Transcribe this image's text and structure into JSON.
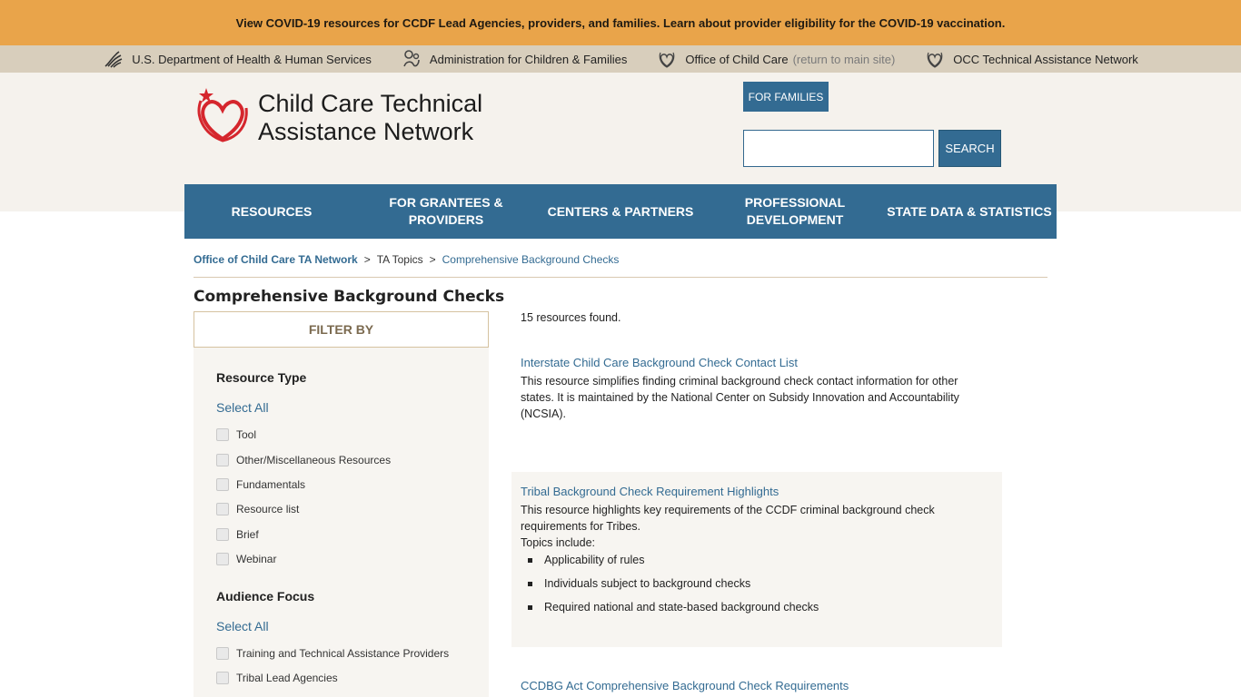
{
  "covid_banner": {
    "text": "View COVID-19 resources for CCDF Lead Agencies, providers, and families. Learn about provider eligibility for the COVID-19 vaccination."
  },
  "agency_bar": {
    "items": [
      {
        "label": "U.S. Department of Health & Human Services",
        "icon": "hhs-eagle-icon"
      },
      {
        "label": "Administration for Children & Families",
        "icon": "acf-icon"
      },
      {
        "label": "Office of Child Care",
        "suffix": "(return to main site)",
        "icon": "occ-heart-icon"
      },
      {
        "label": "OCC Technical Assistance Network",
        "icon": "occ-heart-icon"
      }
    ]
  },
  "header": {
    "logo_line1": "Child Care Technical",
    "logo_line2": "Assistance Network",
    "for_families": "FOR FAMILIES",
    "search_placeholder": "",
    "search_button": "SEARCH"
  },
  "nav": {
    "items": [
      {
        "label": "RESOURCES"
      },
      {
        "label": "FOR GRANTEES & PROVIDERS"
      },
      {
        "label": "CENTERS & PARTNERS"
      },
      {
        "label": "PROFESSIONAL DEVELOPMENT"
      },
      {
        "label": "STATE DATA & STATISTICS"
      }
    ]
  },
  "breadcrumb": {
    "items": [
      "Office of Child Care TA Network",
      "TA Topics",
      "Comprehensive Background Checks"
    ],
    "separator": ">"
  },
  "page_title": "Comprehensive Background Checks",
  "filter": {
    "heading": "FILTER BY",
    "groups": [
      {
        "title": "Resource Type",
        "select_all": "Select All",
        "options": [
          "Tool",
          "Other/Miscellaneous Resources",
          "Fundamentals",
          "Resource list",
          "Brief",
          "Webinar"
        ]
      },
      {
        "title": "Audience Focus",
        "select_all": "Select All",
        "options": [
          "Training and Technical Assistance Providers",
          "Tribal Lead Agencies"
        ]
      }
    ]
  },
  "results": {
    "count_text": "15 resources found.",
    "items": [
      {
        "title": "Interstate Child Care Background Check Contact List",
        "description": "This resource simplifies finding criminal background check contact information for other states. It is maintained by the National Center on Subsidy Innovation and Accountability (NCSIA)."
      },
      {
        "title": "Tribal Background Check Requirement Highlights",
        "description": "This resource highlights key requirements of the CCDF criminal background check requirements for Tribes.",
        "topics_label": "Topics include:",
        "topics": [
          "Applicability of rules",
          "Individuals subject to background checks",
          "Required national and state-based background checks"
        ]
      },
      {
        "title": "CCDBG Act Comprehensive Background Check Requirements"
      }
    ]
  },
  "colors": {
    "banner": "#e9a44a",
    "agency_bar": "#d8cebc",
    "header_bg": "#f5f2ed",
    "primary_blue": "#336b92",
    "logo_red": "#d5262d"
  }
}
